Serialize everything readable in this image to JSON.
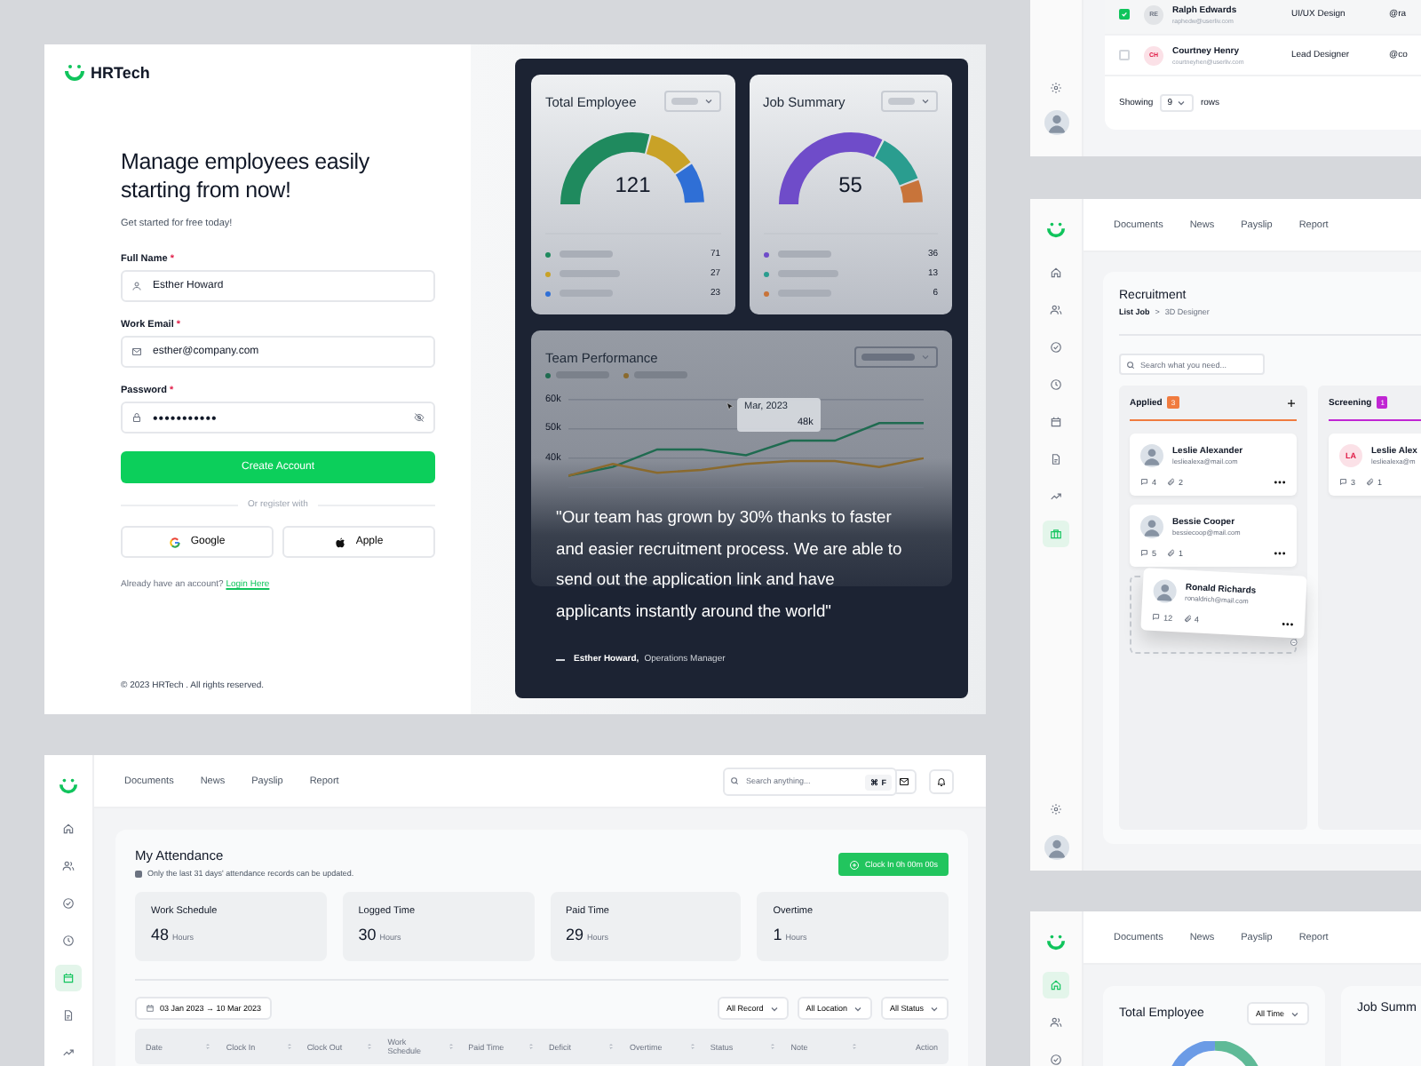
{
  "signup": {
    "logo_text": "HRTech",
    "heading": "Manage employees easily starting from now!",
    "subheading": "Get started for free today!",
    "fields": [
      {
        "label": "Full Name",
        "mark": "*",
        "value": "Esther Howard",
        "kind": "text"
      },
      {
        "label": "Work Email",
        "mark": "*",
        "value": "esther@company.com",
        "kind": "text"
      },
      {
        "label": "Password",
        "mark": "*",
        "value": "•••••••••••",
        "kind": "password"
      }
    ],
    "submit": "Create Account",
    "divider": "Or register with",
    "social": [
      "Google",
      "Apple"
    ],
    "login_prompt": "Already have an account?",
    "login_link": "Login Here",
    "footer": "© 2023 HRTech . All rights reserved."
  },
  "showcase": {
    "cards": [
      {
        "title": "Total Employee",
        "total": "121",
        "legend": [
          {
            "color": "#1f8a5e",
            "value": "71"
          },
          {
            "color": "#c9a227",
            "value": "27"
          },
          {
            "color": "#2f6fd6",
            "value": "23"
          }
        ]
      },
      {
        "title": "Job Summary",
        "total": "55",
        "legend": [
          {
            "color": "#6f4cc9",
            "value": "36"
          },
          {
            "color": "#2a9d8f",
            "value": "13"
          },
          {
            "color": "#c8743a",
            "value": "6"
          }
        ]
      }
    ],
    "performance": {
      "title": "Team Performance",
      "tooltip_date": "Mar, 2023",
      "tooltip_value": "48k",
      "chart_data": {
        "type": "line",
        "categories": [
          null,
          null,
          null,
          null,
          null,
          null,
          null,
          null,
          null
        ],
        "ylim": [
          30,
          60
        ],
        "yticks": [
          {
            "value": 60,
            "label": "60k"
          },
          {
            "value": 50,
            "label": "50k"
          },
          {
            "value": 40,
            "label": "40k"
          }
        ],
        "series": [
          {
            "color": "#1f6b50",
            "values": [
              34,
              37,
              43,
              43,
              41,
              46,
              46,
              52,
              52
            ]
          },
          {
            "color": "#8a6a2e",
            "values": [
              34,
              38,
              35,
              36,
              38,
              39,
              39,
              37,
              40
            ]
          }
        ]
      }
    },
    "quote": "\"Our team has grown by 30% thanks to faster and easier recruitment process. We are able to send out the application link and have applicants instantly around the world\"",
    "author": "Esther Howard,",
    "role": "Operations Manager"
  },
  "team_table": {
    "rows": [
      {
        "checked": true,
        "initials": "RE",
        "color": "#6b7280",
        "name": "Ralph Edwards",
        "email": "raphedw@userliv.com",
        "role": "UI/UX Design",
        "column_4": "@ra"
      },
      {
        "checked": false,
        "initials": "CH",
        "color": "#e11d48",
        "name": "Courtney Henry",
        "email": "courtneyhen@userliv.com",
        "role": "Lead Designer",
        "column_4": "@co"
      }
    ],
    "footer_label": "Showing",
    "page_size": "9",
    "footer_unit": "rows"
  },
  "recruitment": {
    "sidebar": [
      {
        "selected": false
      },
      {
        "selected": false
      },
      {
        "selected": false
      },
      {
        "selected": false
      },
      {
        "selected": false
      },
      {
        "selected": false
      },
      {
        "selected": false
      },
      {
        "selected": true
      }
    ],
    "nav": [
      "Documents",
      "News",
      "Payslip",
      "Report"
    ],
    "title": "Recruitment",
    "breadcrumb": [
      "List Job",
      "3D Designer"
    ],
    "breadcrumb_separator": ">",
    "search_placeholder": "Search what you need...",
    "columns": [
      {
        "title": "Applied",
        "count": "3",
        "color": "#f07b3f",
        "cards": [
          {
            "name": "Leslie Alexander",
            "email": "lesliealexa@mail.com",
            "comments": "4",
            "attachments": "2",
            "dragging": false
          },
          {
            "name": "Bessie Cooper",
            "email": "bessiecoop@mail.com",
            "comments": "5",
            "attachments": "1",
            "dragging": false
          },
          {
            "name": "Ronald Richards",
            "email": "ronaldrich@mail.com",
            "comments": "12",
            "attachments": "4",
            "dragging": true
          }
        ]
      },
      {
        "title": "Screening",
        "count": "1",
        "color": "#c026d3",
        "cards": [
          {
            "initials": "LA",
            "color": "#e11d48",
            "name": "Leslie Alex",
            "email": "lesliealexa@m",
            "comments": "3",
            "attachments": "1",
            "dragging": false
          }
        ]
      }
    ]
  },
  "attendance": {
    "sidebar": [
      {
        "selected": false
      },
      {
        "selected": false
      },
      {
        "selected": false
      },
      {
        "selected": false
      },
      {
        "selected": true
      },
      {
        "selected": false
      },
      {
        "selected": false
      }
    ],
    "nav": [
      "Documents",
      "News",
      "Payslip",
      "Report"
    ],
    "search_placeholder": "Search anything...",
    "shortcut": "⌘ F",
    "title": "My Attendance",
    "note": "Only the last 31 days' attendance records can be updated.",
    "clock_button": "Clock In 0h 00m 00s",
    "stats": [
      {
        "label": "Work Schedule",
        "value": "48",
        "unit": "Hours"
      },
      {
        "label": "Logged Time",
        "value": "30",
        "unit": "Hours"
      },
      {
        "label": "Paid Time",
        "value": "29",
        "unit": "Hours"
      },
      {
        "label": "Overtime",
        "value": "1",
        "unit": "Hours"
      }
    ],
    "date_range": "03 Jan 2023 → 10 Mar 2023",
    "filters": [
      "All Record",
      "All Location",
      "All Status"
    ],
    "columns": [
      {
        "label": "Date",
        "sortable": true
      },
      {
        "label": "Clock In",
        "sortable": true
      },
      {
        "label": "Clock Out",
        "sortable": true
      },
      {
        "label": "Work Schedule",
        "sortable": true
      },
      {
        "label": "Paid Time",
        "sortable": true
      },
      {
        "label": "Deficit",
        "sortable": true
      },
      {
        "label": "Overtime",
        "sortable": true
      },
      {
        "label": "Status",
        "sortable": true
      },
      {
        "label": "Note",
        "sortable": true
      },
      {
        "label": "Action",
        "sortable": false
      }
    ]
  },
  "overview": {
    "sidebar": [
      {
        "selected": true
      },
      {
        "selected": false
      },
      {
        "selected": false
      }
    ],
    "nav": [
      "Documents",
      "News",
      "Payslip",
      "Report"
    ],
    "cards": [
      {
        "title": "Total Employee",
        "filter": "All Time"
      },
      {
        "title": "Job Summ"
      }
    ]
  }
}
